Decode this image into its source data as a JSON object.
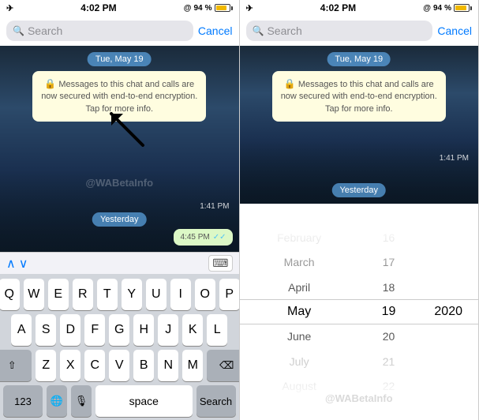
{
  "left_panel": {
    "status": {
      "time": "4:02 PM",
      "battery_pct": 94,
      "signal": "●●●●"
    },
    "search": {
      "placeholder": "Search",
      "cancel_label": "Cancel"
    },
    "chat": {
      "date_badge": "Tue, May 19",
      "encryption_msg": "Messages to this chat and calls are now secured with end-to-end encryption. Tap for more info.",
      "time_sent": "1:41 PM",
      "yesterday_label": "Yesterday",
      "green_msg_time": "4:45 PM",
      "check_mark": "✓✓"
    },
    "keyboard": {
      "rows": [
        [
          "Q",
          "W",
          "E",
          "R",
          "T",
          "Y",
          "U",
          "I",
          "O",
          "P"
        ],
        [
          "A",
          "S",
          "D",
          "F",
          "G",
          "H",
          "J",
          "K",
          "L"
        ],
        [
          "Z",
          "X",
          "C",
          "V",
          "B",
          "N",
          "M"
        ]
      ],
      "bottom": {
        "numbers_label": "123",
        "globe_icon": "🌐",
        "mic_icon": "🎙",
        "space_label": "space",
        "search_label": "Search"
      }
    }
  },
  "right_panel": {
    "status": {
      "time": "4:02 PM",
      "battery_pct": 94
    },
    "search": {
      "placeholder": "Search",
      "cancel_label": "Cancel"
    },
    "date_picker": {
      "months": [
        "February",
        "March",
        "April",
        "May",
        "June",
        "July",
        "August"
      ],
      "days": [
        "16",
        "17",
        "18",
        "19",
        "20",
        "21",
        "22"
      ],
      "years": [
        "",
        "",
        "",
        "2020",
        "",
        "",
        ""
      ],
      "selected_month": "May",
      "selected_day": "19",
      "selected_year": "2020"
    }
  },
  "watermark": "@WABetaInfo"
}
